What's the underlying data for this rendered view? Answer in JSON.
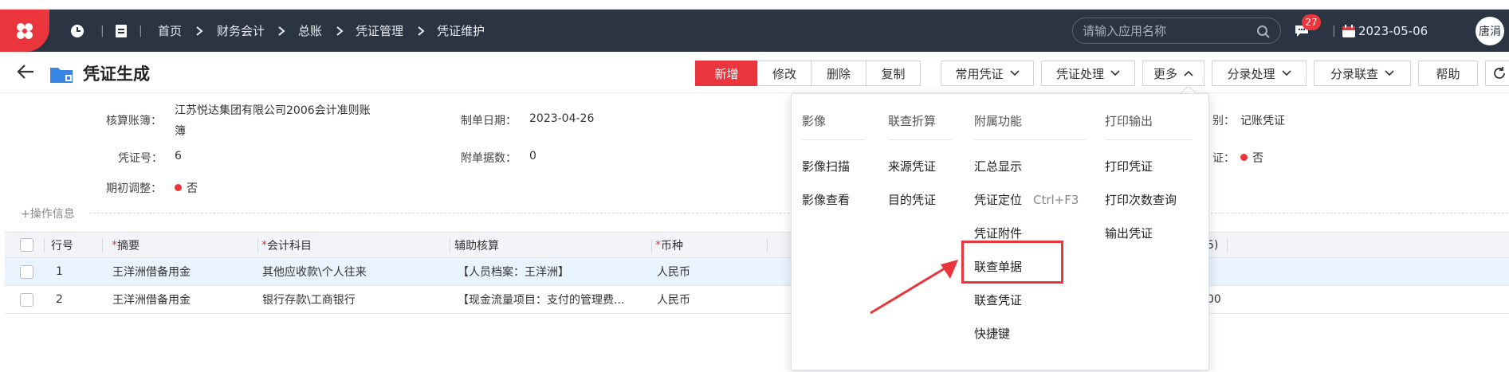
{
  "header": {
    "breadcrumb": [
      "首页",
      "财务会计",
      "总账",
      "凭证管理",
      "凭证维护"
    ],
    "search_placeholder": "请输入应用名称",
    "notification_count": "27",
    "date": "2023-05-06",
    "user": "唐涓"
  },
  "page": {
    "title": "凭证生成"
  },
  "toolbar": {
    "buttons": [
      "新增",
      "修改",
      "删除",
      "复制",
      "常用凭证",
      "凭证处理",
      "更多",
      "分录处理",
      "分录联查",
      "帮助"
    ]
  },
  "form": {
    "account_book_label": "核算账簿：",
    "account_book_value_line1": "江苏悦达集团有限公司2006会计准则账",
    "account_book_value_line2": "簿",
    "date_label": "制单日期：",
    "date_value": "2023-04-26",
    "voucher_no_label": "凭证号：",
    "voucher_no_value": "6",
    "attachments_label": "附单据数：",
    "attachments_value": "0",
    "initial_adjust_label": "期初调整：",
    "initial_adjust_value": "否",
    "category_label_partial": "别：",
    "category_value": "记账凭证",
    "certify_label_partial": "证：",
    "certify_value": "否",
    "op_info": "+操作信息"
  },
  "table": {
    "headers": [
      "行号",
      "摘要",
      "会计科目",
      "辅助核算",
      "币种"
    ],
    "partial_header": "5)",
    "rows": [
      {
        "no": "1",
        "summary": "王洋洲借备用金",
        "account": "其他应收款\\个人往来",
        "aux": "【人员档案：王洋洲】",
        "currency": "人民币",
        "extra": ""
      },
      {
        "no": "2",
        "summary": "王洋洲借备用金",
        "account": "银行存款\\工商银行",
        "aux": "【现金流量项目：支付的管理费...",
        "currency": "人民币",
        "extra": "00"
      }
    ]
  },
  "more_menu": {
    "columns": [
      {
        "header": "影像",
        "items": [
          "影像扫描",
          "影像查看"
        ]
      },
      {
        "header": "联查折算",
        "items": [
          "来源凭证",
          "目的凭证"
        ]
      },
      {
        "header": "附属功能",
        "items": [
          "汇总显示",
          "凭证定位",
          "凭证附件",
          "联查单据",
          "联查凭证",
          "快捷键"
        ],
        "shortcut": "Ctrl+F3"
      },
      {
        "header": "打印输出",
        "items": [
          "打印凭证",
          "打印次数查询",
          "输出凭证"
        ]
      }
    ]
  },
  "colors": {
    "brand_red": "#e9353b",
    "header_bg": "#2b3443"
  }
}
